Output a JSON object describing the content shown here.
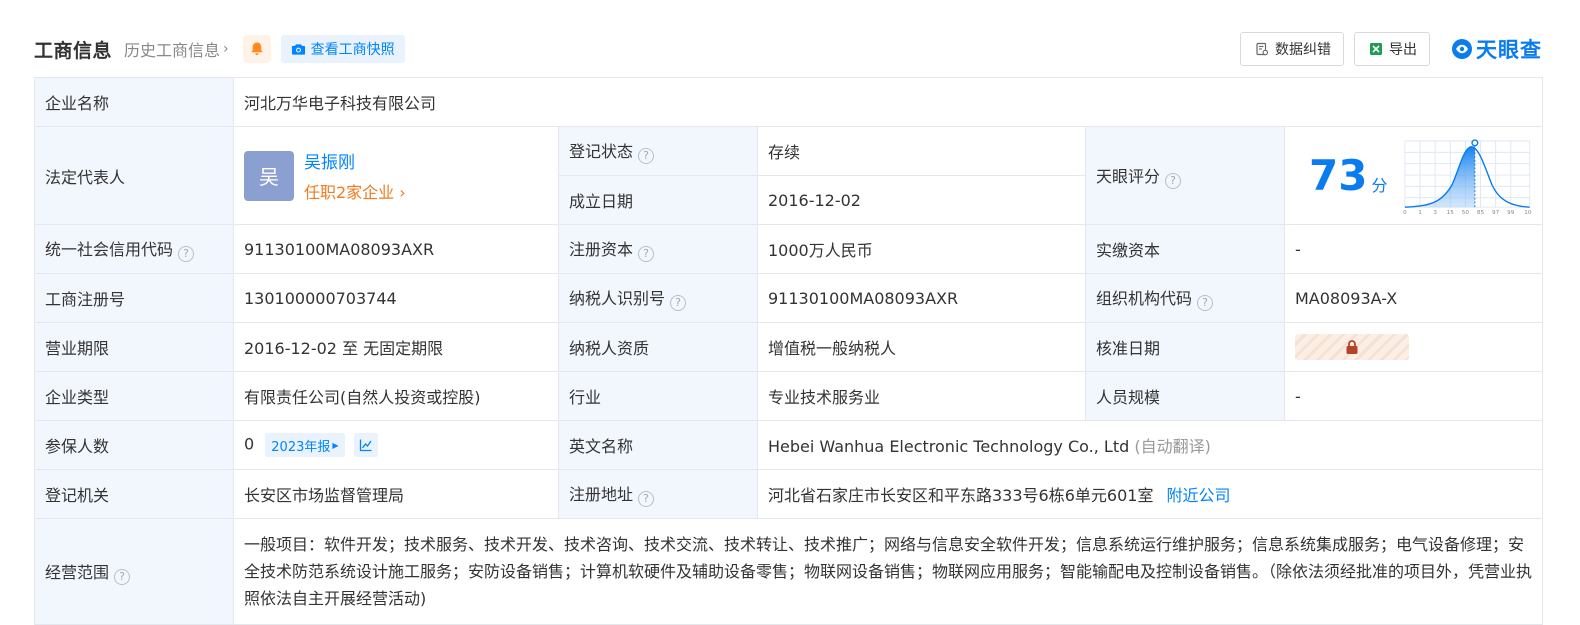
{
  "header": {
    "title": "工商信息",
    "history_link": "历史工商信息",
    "snapshot_button": "查看工商快照",
    "error_button": "数据纠错",
    "export_button": "导出",
    "logo_text": "天眼查"
  },
  "colors": {
    "accent": "#0084ff",
    "label_bg": "#f2f7fe",
    "status_green": "#3bab57",
    "highlight_orange": "#f17b1f"
  },
  "company": {
    "name_label": "企业名称",
    "name": "河北万华电子科技有限公司",
    "legal_rep_label": "法定代表人",
    "legal_rep_avatar": "吴",
    "legal_rep_name": "吴振刚",
    "legal_rep_jobs": "任职2家企业",
    "status_label": "登记状态",
    "status": "存续",
    "founded_label": "成立日期",
    "founded": "2016-12-02",
    "score_label": "天眼评分",
    "score": "73",
    "score_unit": "分",
    "score_axis": [
      "0",
      "1",
      "3",
      "15",
      "50",
      "85",
      "97",
      "99",
      "100"
    ],
    "credit_code_label": "统一社会信用代码",
    "credit_code": "91130100MA08093AXR",
    "reg_capital_label": "注册资本",
    "reg_capital": "1000万人民币",
    "paid_capital_label": "实缴资本",
    "paid_capital": "-",
    "biz_reg_no_label": "工商注册号",
    "biz_reg_no": "130100000703744",
    "taxpayer_id_label": "纳税人识别号",
    "taxpayer_id": "91130100MA08093AXR",
    "org_code_label": "组织机构代码",
    "org_code": "MA08093A-X",
    "term_label": "营业期限",
    "term": "2016-12-02 至 无固定期限",
    "tax_qual_label": "纳税人资质",
    "tax_qual": "增值税一般纳税人",
    "approval_label": "核准日期",
    "type_label": "企业类型",
    "type": "有限责任公司(自然人投资或控股)",
    "industry_label": "行业",
    "industry": "专业技术服务业",
    "staff_label": "人员规模",
    "staff": "-",
    "insured_label": "参保人数",
    "insured": "0",
    "insured_report": "2023年报",
    "english_label": "英文名称",
    "english_name": "Hebei Wanhua Electronic Technology Co., Ltd",
    "english_note": "(自动翻译)",
    "authority_label": "登记机关",
    "authority": "长安区市场监督管理局",
    "address_label": "注册地址",
    "address": "河北省石家庄市长安区和平东路333号6栋6单元601室",
    "nearby_link": "附近公司",
    "scope_label": "经营范围",
    "scope": "一般项目：软件开发；技术服务、技术开发、技术咨询、技术交流、技术转让、技术推广；网络与信息安全软件开发；信息系统运行维护服务；信息系统集成服务；电气设备修理；安全技术防范系统设计施工服务；安防设备销售；计算机软硬件及辅助设备零售；物联网设备销售；物联网应用服务；智能输配电及控制设备销售。（除依法须经批准的项目外，凭营业执照依法自主开展经营活动)"
  }
}
